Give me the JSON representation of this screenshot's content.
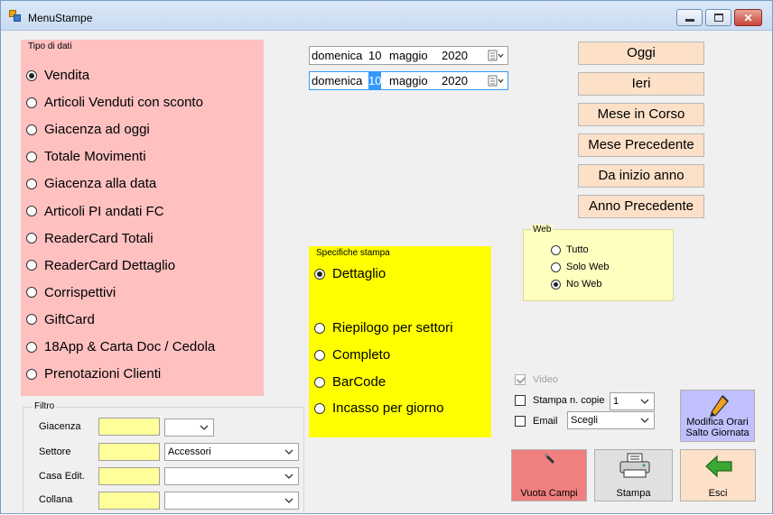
{
  "window": {
    "title": "MenuStampe"
  },
  "tipo_dati": {
    "title": "Tipo di dati",
    "options": [
      {
        "label": "Vendita",
        "selected": true
      },
      {
        "label": "Articoli Venduti con sconto",
        "selected": false
      },
      {
        "label": "Giacenza ad oggi",
        "selected": false
      },
      {
        "label": "Totale Movimenti",
        "selected": false
      },
      {
        "label": "Giacenza alla data",
        "selected": false
      },
      {
        "label": "Articoli PI andati FC",
        "selected": false
      },
      {
        "label": "ReaderCard Totali",
        "selected": false
      },
      {
        "label": "ReaderCard Dettaglio",
        "selected": false
      },
      {
        "label": "Corrispettivi",
        "selected": false
      },
      {
        "label": "GiftCard",
        "selected": false
      },
      {
        "label": "18App & Carta Doc / Cedola",
        "selected": false
      },
      {
        "label": "Prenotazioni Clienti",
        "selected": false
      }
    ]
  },
  "filtro": {
    "title": "Filtro",
    "rows": [
      {
        "label": "Giacenza",
        "combo_value": ""
      },
      {
        "label": "Settore",
        "combo_value": "Accessori"
      },
      {
        "label": "Casa Edit.",
        "combo_value": ""
      },
      {
        "label": "Collana",
        "combo_value": ""
      }
    ]
  },
  "dates": {
    "from": {
      "weekday": "domenica",
      "day": "10",
      "month": "maggio",
      "year": "2020"
    },
    "to": {
      "weekday": "domenica",
      "day": "10",
      "month": "maggio",
      "year": "2020"
    }
  },
  "quick_buttons": [
    "Oggi",
    "Ieri",
    "Mese in Corso",
    "Mese Precedente",
    "Da inizio anno",
    "Anno Precedente"
  ],
  "web": {
    "title": "Web",
    "options": [
      {
        "label": "Tutto",
        "selected": false
      },
      {
        "label": "Solo Web",
        "selected": false
      },
      {
        "label": "No Web",
        "selected": true
      }
    ]
  },
  "specifiche": {
    "title": "Specifiche stampa",
    "options": [
      {
        "label": "Dettaglio",
        "selected": true
      },
      {
        "label": "Riepilogo per settori",
        "selected": false
      },
      {
        "label": "Completo",
        "selected": false
      },
      {
        "label": "BarCode",
        "selected": false
      },
      {
        "label": "Incasso per giorno",
        "selected": false
      }
    ]
  },
  "options": {
    "video_label": "Video",
    "stampa_copie_label": "Stampa n. copie",
    "copies_value": "1",
    "email_label": "Email",
    "email_value": "Scegli"
  },
  "actions": {
    "modifica_line1": "Modifica Orari",
    "modifica_line2": "Salto Giornata",
    "vuota_label": "Vuota Campi",
    "stampa_label": "Stampa",
    "esci_label": "Esci"
  },
  "colors": {
    "tipo_bg": "#ffc0c0",
    "spec_bg": "#ffff00",
    "web_bg": "#ffffc0",
    "quick_btn_bg": "#fce0c8",
    "vuota_bg": "#f08080",
    "stampa_bg": "#e0e0e0",
    "esci_bg": "#fce0c8",
    "modifica_bg": "#c0c0ff"
  }
}
